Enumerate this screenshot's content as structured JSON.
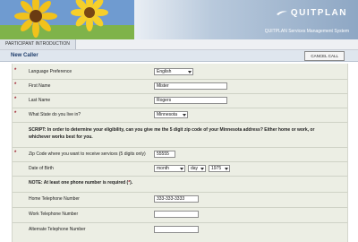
{
  "header": {
    "brand": "QUITPLAN",
    "subtitle": "QUITPLAN Services Management System"
  },
  "nav": {
    "tab": "PARTICIPANT INTRODUCTION"
  },
  "titlebar": {
    "title": "New Caller",
    "cancel_label": "CANCEL CALL"
  },
  "form": {
    "language": {
      "label": "Language Preference",
      "value": "English"
    },
    "first_name": {
      "label": "First Name",
      "value": "Mister"
    },
    "last_name": {
      "label": "Last Name",
      "value": "Rogers"
    },
    "state": {
      "label": "What State do you live in?",
      "value": "Minnesota"
    },
    "script": {
      "prefix": "SCRIPT: In order to determine your eligibility, can you give me the 5 digit zip code of your Minnesota address? Either home or work, or whichever works best for you."
    },
    "zip": {
      "label": "Zip Code where you want to receive services (5 digits only)",
      "value": "55555"
    },
    "dob": {
      "label": "Date of Birth",
      "month": "month",
      "day": "day",
      "year": "1975"
    },
    "note": {
      "text": "NOTE: At least one phone number is required (",
      "star": "*",
      "end": ")."
    },
    "home_phone": {
      "label": "Home Telephone Number",
      "value": "333-333-3333"
    },
    "work_phone": {
      "label": "Work Telephone Number",
      "value": ""
    },
    "alt_phone": {
      "label": "Alternate Telephone Number",
      "value": ""
    }
  },
  "colors": {
    "brand_blue": "#8ea7c4",
    "required_star": "#a02030",
    "form_bg": "#eceee4"
  }
}
